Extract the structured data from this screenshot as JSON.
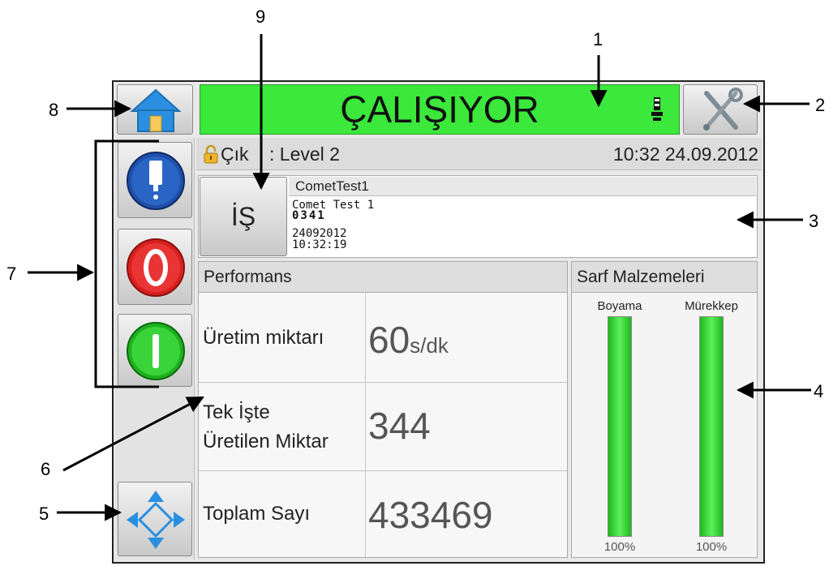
{
  "status": {
    "text": "ÇALIŞIYOR",
    "color": "#3be83b"
  },
  "info": {
    "user_prefix": "Çık",
    "user_level": ": Level 2",
    "datetime": "10:32 24.09.2012"
  },
  "job": {
    "button_label": "İŞ",
    "name": "CometTest1",
    "preview_lines": [
      "Comet Test 1",
      "0341",
      "24092012",
      "10:32:19"
    ]
  },
  "performance": {
    "title": "Performans",
    "rows": [
      {
        "label": "Üretim miktarı",
        "value": "60",
        "unit": "s/dk"
      },
      {
        "label": "Tek İşte Üretilen Miktar",
        "label_line1": "Tek İşte",
        "label_line2": "Üretilen Miktar",
        "value": "344",
        "unit": ""
      },
      {
        "label": "Toplam Sayı",
        "value": "433469",
        "unit": ""
      }
    ]
  },
  "supplies": {
    "title": "Sarf Malzemeleri",
    "items": [
      {
        "label": "Boyama",
        "level": 100,
        "percent_text": "100%"
      },
      {
        "label": "Mürekkep",
        "level": 100,
        "percent_text": "100%"
      }
    ]
  },
  "icons": {
    "home": "home-icon",
    "tools": "tools-icon",
    "lamp": "beacon-icon",
    "lock": "lock-icon",
    "ink": "ink-cartridge-icon",
    "stop": "stop-icon",
    "start": "start-icon",
    "nav": "navigation-arrows-icon"
  },
  "callouts": [
    "1",
    "2",
    "3",
    "4",
    "5",
    "6",
    "7",
    "8",
    "9"
  ]
}
